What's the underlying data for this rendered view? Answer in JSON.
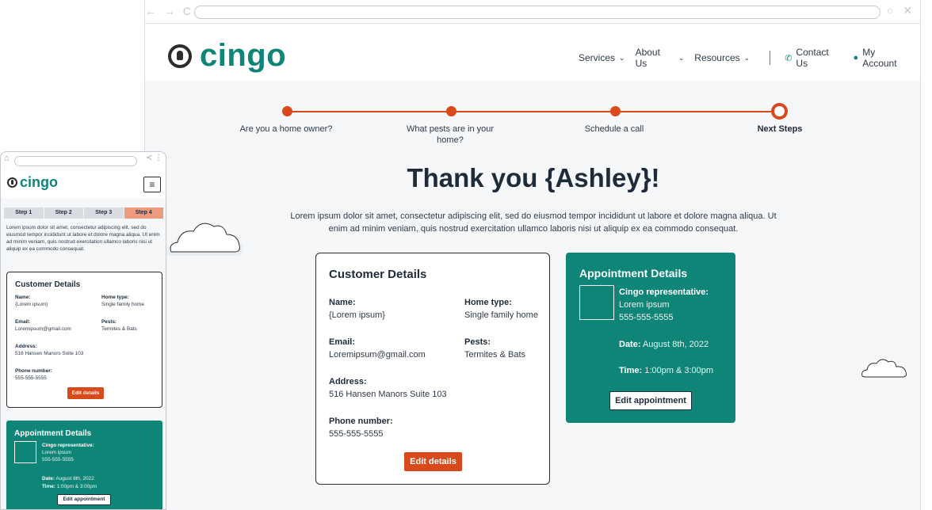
{
  "brand": {
    "name": "cingo",
    "accent": "#0f8577",
    "orange": "#d84a1b"
  },
  "browser": {
    "nav_icons": "← → C",
    "window_icons": "○ ✕"
  },
  "nav": {
    "services": "Services",
    "about": "About Us",
    "resources": "Resources",
    "contact": "Contact Us",
    "account": "My Account"
  },
  "steps": [
    {
      "label": "Are you a home owner?"
    },
    {
      "label": "What pests are in your home?"
    },
    {
      "label": "Schedule a call"
    },
    {
      "label": "Next Steps"
    }
  ],
  "title": "Thank you {Ashley}!",
  "lead": "Lorem ipsum dolor sit amet, consectetur adipiscing elit, sed do eiusmod tempor incididunt ut labore et dolore magna aliqua. Ut enim ad minim veniam, quis nostrud exercitation ullamco laboris nisi ut aliquip ex ea commodo consequat.",
  "customer": {
    "heading": "Customer Details",
    "name_label": "Name:",
    "name": "{Lorem ipsum}",
    "home_label": "Home type:",
    "home": "Single family home",
    "email_label": "Email:",
    "email": "Loremipsum@gmail.com",
    "pests_label": "Pests:",
    "pests": "Termites & Bats",
    "address_label": "Address:",
    "address": "516 Hansen Manors Suite 103",
    "phone_label": "Phone number:",
    "phone": "555-555-5555",
    "edit": "Edit details"
  },
  "appointment": {
    "heading": "Appointment Details",
    "rep_label": "Cingo representative:",
    "rep_name": "Lorem ipsum",
    "rep_phone": "555-555-5555",
    "date_label": "Date:",
    "date": "August 8th, 2022",
    "time_label": "Time:",
    "time": "1:00pm & 3:00pm",
    "edit": "Edit appointment"
  },
  "mobile": {
    "steps": [
      "Step 1",
      "Step 2",
      "Step 3",
      "Step 4"
    ],
    "menu_icon": "≡",
    "share_icons": "≺ ⋮"
  }
}
